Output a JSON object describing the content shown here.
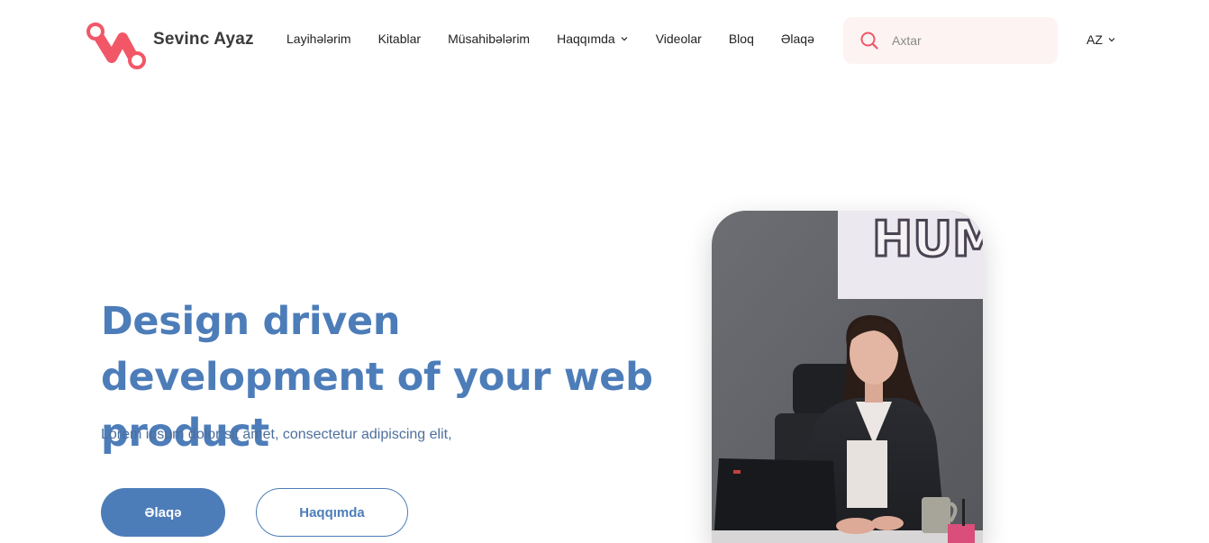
{
  "brand": {
    "name": "Sevinc Ayaz",
    "logo_icon": "infinity-loop-logo",
    "color": "#f25767"
  },
  "nav": {
    "items": [
      {
        "label": "Layihələrim"
      },
      {
        "label": "Kitablar"
      },
      {
        "label": "Müsahibələrim"
      },
      {
        "label": "Haqqımda",
        "has_dropdown": true
      },
      {
        "label": "Videolar"
      },
      {
        "label": "Bloq"
      },
      {
        "label": "Əlaqə"
      }
    ]
  },
  "search": {
    "placeholder": "Axtar",
    "icon": "search-icon",
    "value": ""
  },
  "language": {
    "current": "AZ"
  },
  "hero": {
    "title": "Design driven development of your web product",
    "subtitle": "Lorem ipsum dolor sit amet, consectetur adipiscing elit,",
    "primary_button": "Əlaqə",
    "secondary_button": "Haqqımda",
    "accent_color": "#4d7db9"
  },
  "photo": {
    "poster_text": "HUM"
  }
}
